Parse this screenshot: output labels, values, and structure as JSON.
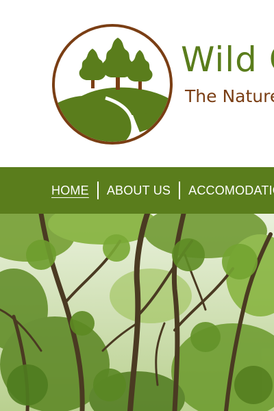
{
  "brand": {
    "name": "Wild O",
    "tagline": "The Nature",
    "logo_icon": "trees-landscape-logo"
  },
  "nav": {
    "items": [
      {
        "label": "HOME",
        "active": true
      },
      {
        "label": "ABOUT US",
        "active": false
      },
      {
        "label": "ACCOMODATION",
        "active": false
      }
    ]
  },
  "hero": {
    "image": "forest-trees-photo"
  },
  "colors": {
    "brand_green": "#5a7d1c",
    "brand_brown": "#7a3e14",
    "nav_text": "#ffffff"
  }
}
